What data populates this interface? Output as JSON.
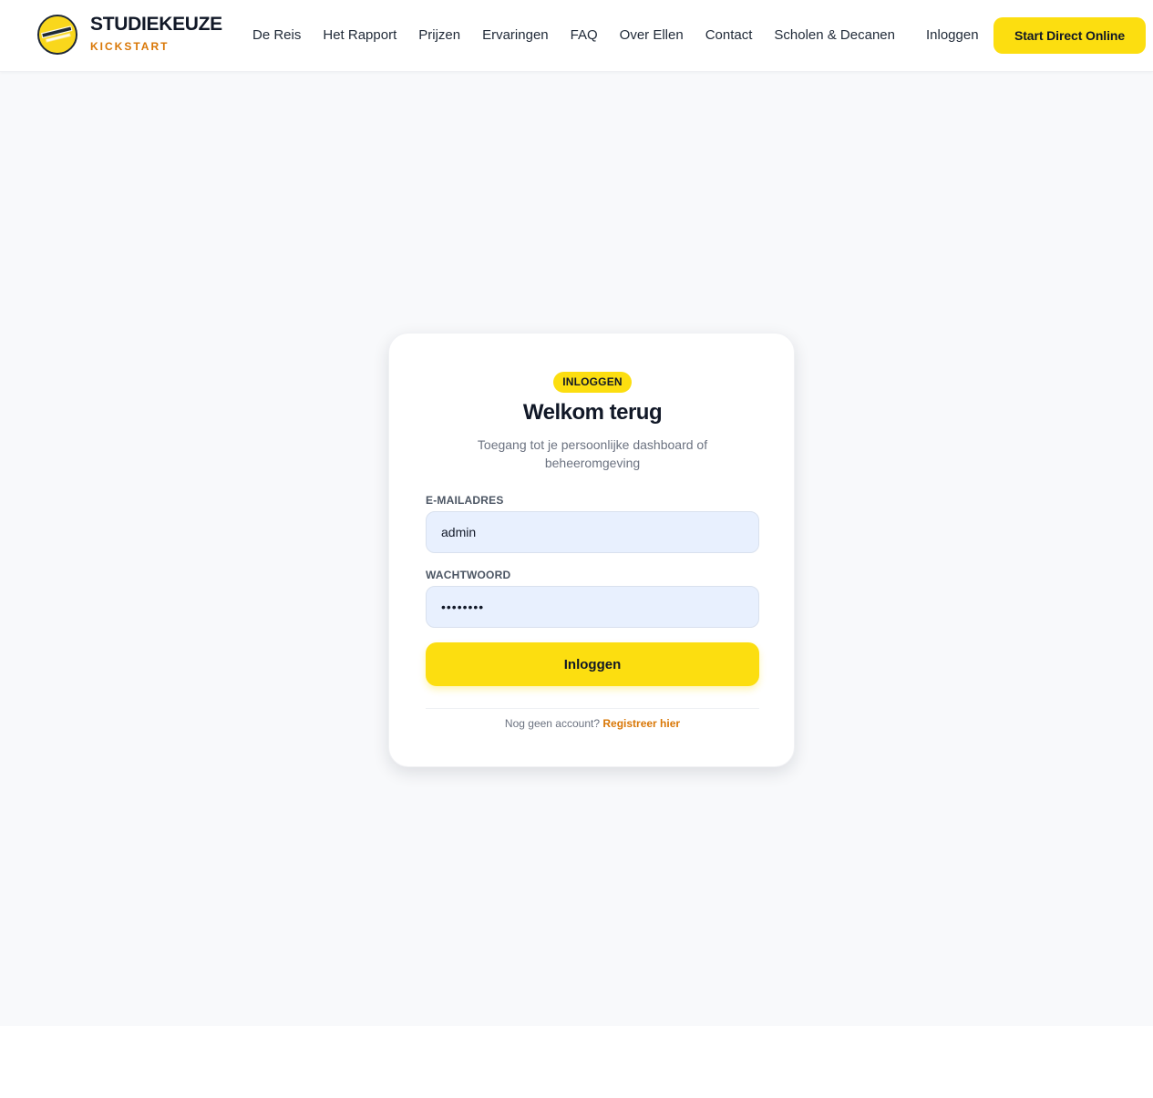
{
  "header": {
    "logo_icon": "studiekeuze-logo-icon",
    "brand_title": "STUDIEKEUZE",
    "brand_subtitle": "KICKSTART",
    "nav": [
      {
        "label": "De Reis"
      },
      {
        "label": "Het Rapport"
      },
      {
        "label": "Prijzen"
      },
      {
        "label": "Ervaringen"
      },
      {
        "label": "FAQ"
      },
      {
        "label": "Over Ellen"
      },
      {
        "label": "Contact"
      },
      {
        "label": "Scholen & Decanen"
      }
    ],
    "login_label": "Inloggen",
    "cta_label": "Start Direct Online"
  },
  "login_card": {
    "badge": "INLOGGEN",
    "title": "Welkom terug",
    "subtitle": "Toegang tot je persoonlijke dashboard of beheeromgeving",
    "email_label": "E-MAILADRES",
    "email_value": "admin",
    "password_label": "WACHTWOORD",
    "password_value": "••••••••",
    "submit_label": "Inloggen",
    "no_account_text": "Nog geen account?",
    "register_label": "Registreer hier"
  },
  "colors": {
    "accent_yellow": "#fcde10",
    "accent_orange": "#d97706",
    "input_bg": "#e8f0fe",
    "page_bg": "#f8f9fb"
  }
}
